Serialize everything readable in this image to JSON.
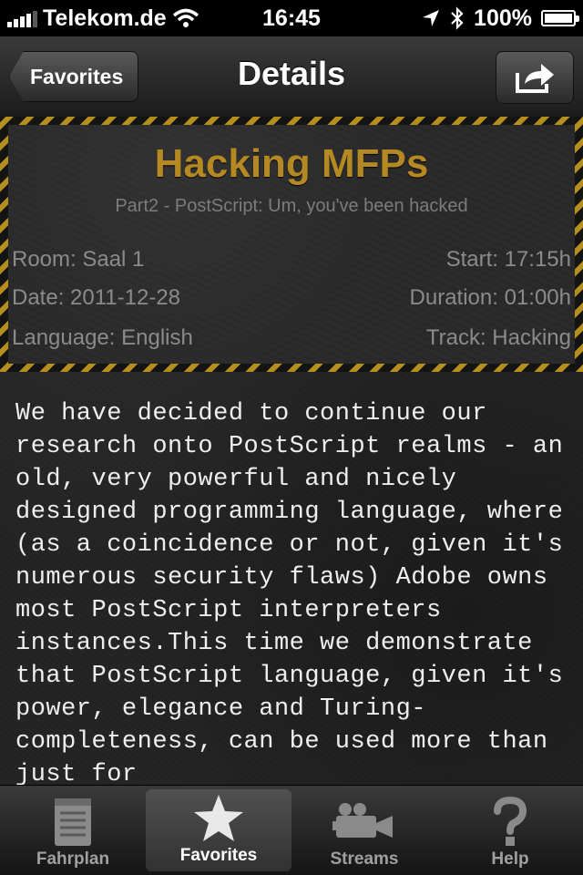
{
  "status_bar": {
    "carrier": "Telekom.de",
    "time": "16:45",
    "battery": "100%"
  },
  "nav": {
    "back_label": "Favorites",
    "title": "Details"
  },
  "event": {
    "title": "Hacking MFPs",
    "subtitle": "Part2 - PostScript: Um, you've been hacked",
    "room": "Room: Saal 1",
    "start": "Start: 17:15h",
    "date": "Date: 2011-12-28",
    "duration": "Duration: 01:00h",
    "language": "Language: English",
    "track": "Track: Hacking"
  },
  "description": "We have decided to continue our research onto PostScript realms - an old, very powerful and nicely designed programming language, where (as a coincidence or not, given it's numerous security flaws) Adobe owns most PostScript interpreters instances.This time we demonstrate that PostScript language, given it's power, elegance and Turing-completeness, can be used more than just for",
  "tabs": [
    {
      "label": "Fahrplan",
      "icon": "notepad-icon"
    },
    {
      "label": "Favorites",
      "icon": "star-icon"
    },
    {
      "label": "Streams",
      "icon": "video-camera-icon"
    },
    {
      "label": "Help",
      "icon": "question-mark-icon"
    }
  ],
  "colors": {
    "title_accent": "#b48822",
    "hazard_stripe": "#b58f1e"
  }
}
